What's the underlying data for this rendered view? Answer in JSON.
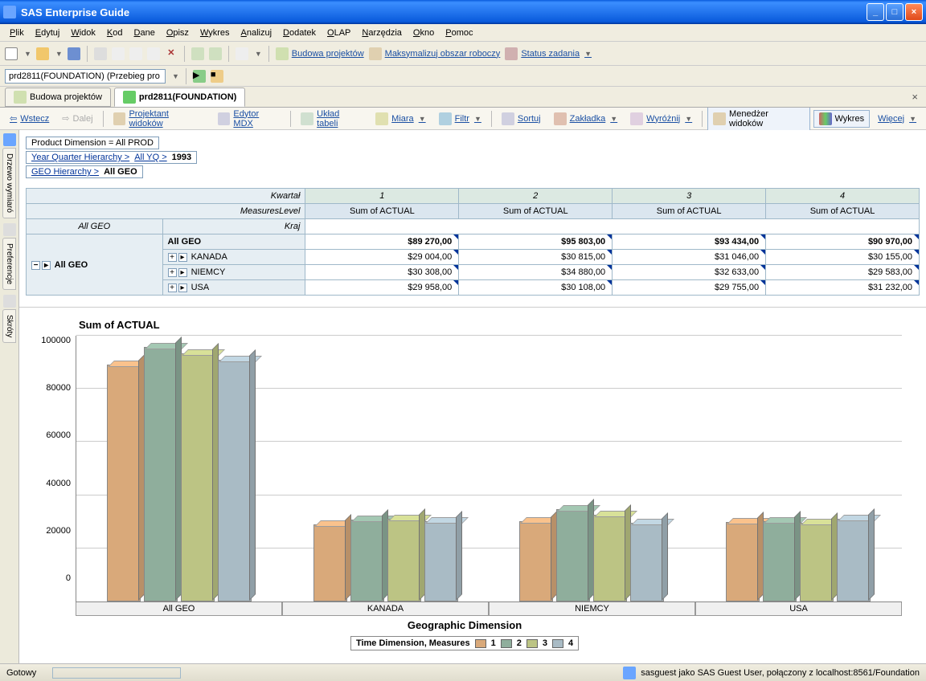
{
  "title": "SAS Enterprise Guide",
  "menu": [
    "Plik",
    "Edytuj",
    "Widok",
    "Kod",
    "Dane",
    "Opisz",
    "Wykres",
    "Analizuj",
    "Dodatek",
    "OLAP",
    "Narzędzia",
    "Okno",
    "Pomoc"
  ],
  "tb1": {
    "budowa": "Budowa projektów",
    "maks": "Maksymalizuj obszar roboczy",
    "status": "Status zadania"
  },
  "loc": "prd2811(FOUNDATION) (Przebieg pro",
  "tabs": {
    "t1": "Budowa projektów",
    "t2": "prd2811(FOUNDATION)"
  },
  "tb2": {
    "wstecz": "Wstecz",
    "dalej": "Dalej",
    "proj": "Projektant widoków",
    "mdx": "Edytor MDX",
    "uklad": "Układ tabeli",
    "miara": "Miara",
    "filtr": "Filtr",
    "sortuj": "Sortuj",
    "zakladka": "Zakładka",
    "wyroznij": "Wyróżnij",
    "menedzer": "Menedżer widoków",
    "wykres": "Wykres",
    "wiecej": "Więcej"
  },
  "crumbs": {
    "prod": "Product Dimension = All PROD",
    "yq": "Year Quarter Hierarchy >",
    "allyq": "All YQ >",
    "year": "1993",
    "geo": "GEO Hierarchy >",
    "allgeo": "All GEO"
  },
  "pivot": {
    "kwartal": "Kwartał",
    "mlevel": "MeasuresLevel",
    "kraj": "Kraj",
    "cols": [
      "1",
      "2",
      "3",
      "4"
    ],
    "sub": "Sum of ACTUAL",
    "allgeo": "All GEO",
    "rows": [
      {
        "name": "All GEO",
        "v": [
          "$89 270,00",
          "$95 803,00",
          "$93 434,00",
          "$90 970,00"
        ],
        "bold": true
      },
      {
        "name": "KANADA",
        "v": [
          "$29 004,00",
          "$30 815,00",
          "$31 046,00",
          "$30 155,00"
        ]
      },
      {
        "name": "NIEMCY",
        "v": [
          "$30 308,00",
          "$34 880,00",
          "$32 633,00",
          "$29 583,00"
        ]
      },
      {
        "name": "USA",
        "v": [
          "$29 958,00",
          "$30 108,00",
          "$29 755,00",
          "$31 232,00"
        ]
      }
    ]
  },
  "chart_data": {
    "type": "bar",
    "title": "Sum of ACTUAL",
    "xlabel": "Geographic Dimension",
    "ylabel": "",
    "ylim": [
      0,
      100000
    ],
    "yticks": [
      0,
      20000,
      40000,
      60000,
      80000,
      100000
    ],
    "categories": [
      "All GEO",
      "KANADA",
      "NIEMCY",
      "USA"
    ],
    "series": [
      {
        "name": "1",
        "values": [
          89270,
          29004,
          30308,
          29958
        ]
      },
      {
        "name": "2",
        "values": [
          95803,
          30815,
          34880,
          30108
        ]
      },
      {
        "name": "3",
        "values": [
          93434,
          31046,
          32633,
          29755
        ]
      },
      {
        "name": "4",
        "values": [
          90970,
          30155,
          29583,
          31232
        ]
      }
    ],
    "legend_title": "Time Dimension,  Measures"
  },
  "vtabs": [
    "Drzewo wymiaró",
    "Preferencje",
    "Skróty"
  ],
  "status": {
    "ready": "Gotowy",
    "conn": "sasguest jako SAS Guest User, połączony z localhost:8561/Foundation"
  }
}
